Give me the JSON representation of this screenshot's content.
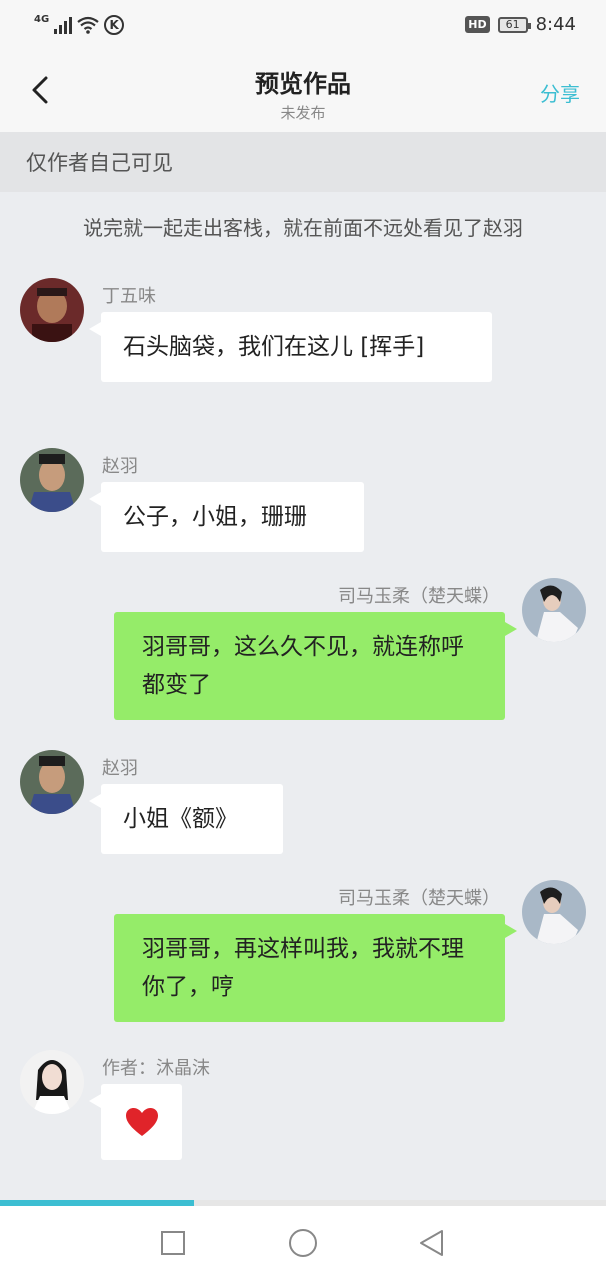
{
  "status_bar": {
    "network": "4G",
    "battery": "61",
    "hd": "HD",
    "time": "8:44"
  },
  "header": {
    "title": "预览作品",
    "subtitle": "未发布",
    "share_label": "分享"
  },
  "privacy_notice": "仅作者自己可见",
  "narration": "说完就一起走出客栈，就在前面不远处看见了赵羽",
  "messages": [
    {
      "side": "left",
      "name": "丁五味",
      "text": "石头脑袋，我们在这儿 [挥手]"
    },
    {
      "side": "left",
      "name": "赵羽",
      "text": "公子，小姐，珊珊"
    },
    {
      "side": "right",
      "name": "司马玉柔（楚天蝶）",
      "text": "羽哥哥，这么久不见，就连称呼都变了"
    },
    {
      "side": "left",
      "name": "赵羽",
      "text": "小姐《额》"
    },
    {
      "side": "right",
      "name": "司马玉柔（楚天蝶）",
      "text": "羽哥哥，再这样叫我，我就不理你了，哼"
    },
    {
      "side": "left",
      "name": "作者：沐晶沫",
      "text": "",
      "icon": "heart-icon"
    }
  ],
  "progress": 0.32,
  "colors": {
    "accent": "#3cbed2",
    "bubble_green": "#95ec69",
    "bubble_white": "#ffffff",
    "heart": "#e0242a"
  }
}
